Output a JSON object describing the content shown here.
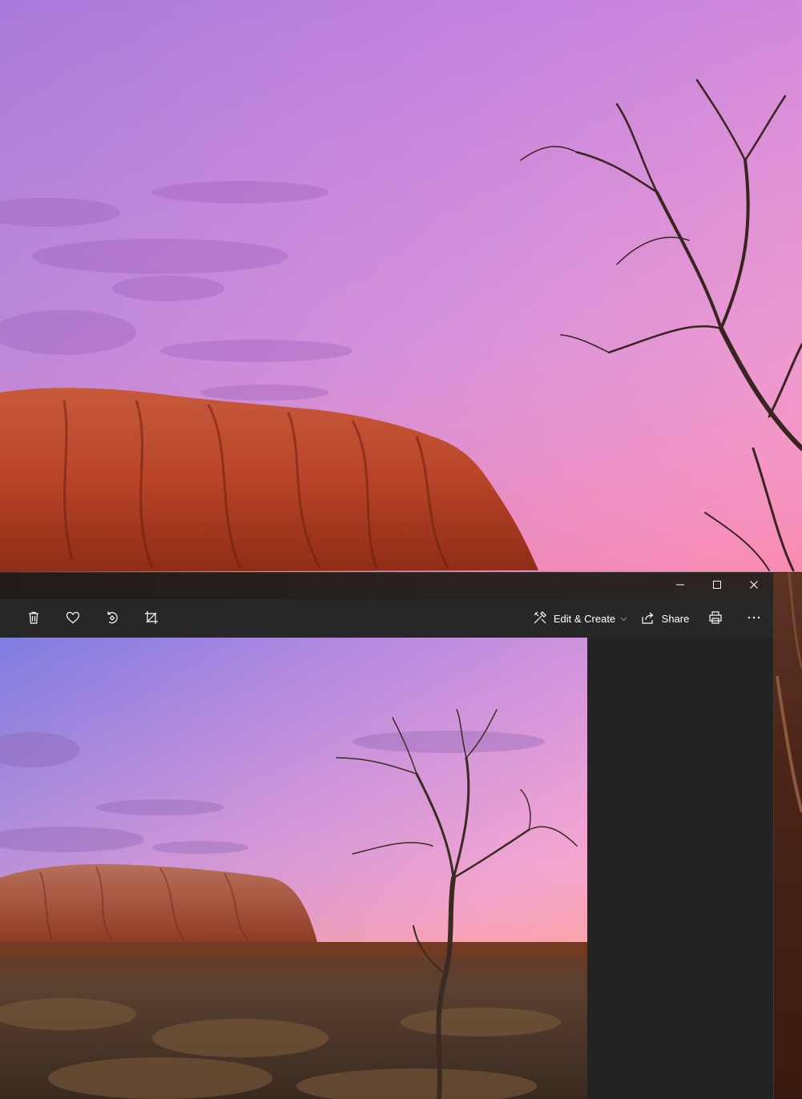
{
  "window": {
    "controls": {
      "minimize_icon": "minimize-icon",
      "maximize_icon": "maximize-icon",
      "close_icon": "close-icon"
    }
  },
  "toolbar": {
    "delete_icon": "trash-icon",
    "favorite_icon": "heart-icon",
    "rotate_icon": "rotate-icon",
    "crop_icon": "crop-icon",
    "edit_create_label": "Edit & Create",
    "share_label": "Share",
    "print_icon": "printer-icon",
    "more_icon": "more-icon"
  },
  "colors": {
    "window_bg": "#272727",
    "side_panel_bg": "#232323",
    "text": "#ffffff"
  }
}
